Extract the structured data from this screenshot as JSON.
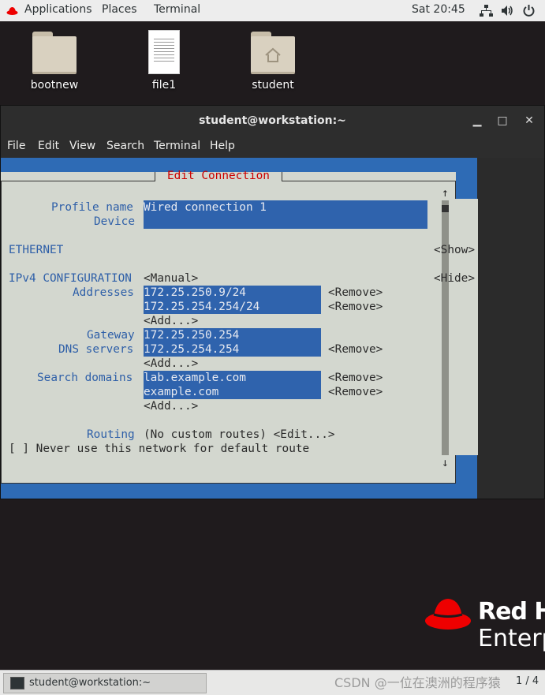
{
  "topbar": {
    "applications": "Applications",
    "places": "Places",
    "terminal": "Terminal",
    "clock": "Sat 20:45",
    "icons": [
      "network-icon",
      "volume-icon",
      "power-icon"
    ]
  },
  "desktop": {
    "icons": [
      {
        "label": "bootnew",
        "type": "folder"
      },
      {
        "label": "file1",
        "type": "document"
      },
      {
        "label": "student",
        "type": "home-folder"
      }
    ]
  },
  "window": {
    "title": "student@workstation:~",
    "buttons": {
      "minimize": "▁",
      "maximize": "□",
      "close": "✕"
    },
    "menu": [
      "File",
      "Edit",
      "View",
      "Search",
      "Terminal",
      "Help"
    ]
  },
  "nmtui": {
    "title": "Edit Connection",
    "profile_label": "Profile name",
    "profile_value": "Wired connection 1",
    "device_label": "Device",
    "device_value": "",
    "ethernet_label": "ETHERNET",
    "show_btn": "<Show>",
    "ipv4_label": "IPv4 CONFIGURATION",
    "ipv4_mode": "<Manual>",
    "hide_btn": "<Hide>",
    "addresses_label": "Addresses",
    "addresses": [
      "172.25.250.9/24",
      "172.25.254.254/24"
    ],
    "remove_btn": "<Remove>",
    "add_btn": "<Add...>",
    "gateway_label": "Gateway",
    "gateway_value": "172.25.250.254",
    "dns_label": "DNS servers",
    "dns_values": [
      "172.25.254.254"
    ],
    "search_label": "Search domains",
    "search_values": [
      "lab.example.com",
      "example.com"
    ],
    "routing_label": "Routing",
    "routing_value": "(No custom routes) <Edit...>",
    "never_default": "[ ] Never use this network for default route",
    "scroll_up": "↑",
    "scroll_down": "↓"
  },
  "brand": {
    "line1": "Red Ha",
    "line2": "Enterp",
    "hat_color": "#ee0000"
  },
  "taskbar": {
    "item": "student@workstation:~",
    "pager": "1 / 4"
  },
  "watermark": "CSDN @一位在澳洲的程序猿"
}
